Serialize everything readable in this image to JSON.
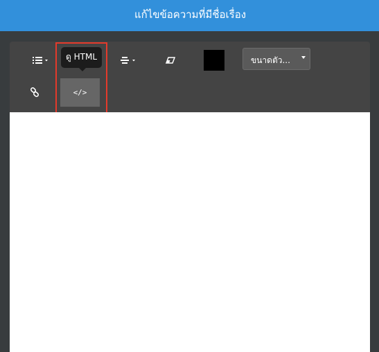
{
  "header": {
    "title": "แก้ไขข้อความที่มีชื่อเรื่อง"
  },
  "toolbar": {
    "list_icon": "list-icon",
    "align_icon": "align-center-icon",
    "eraser_icon": "eraser-icon",
    "link_icon": "link-icon",
    "code_icon": "code-icon",
    "color_swatch": "#000000",
    "font_size_label": "ขนาดตัว...",
    "code_glyph": "</>",
    "tooltip_text": "ดู HTML"
  },
  "colors": {
    "header_bg": "#3290db",
    "toolbar_bg": "#444444",
    "highlight": "#e53a2b"
  }
}
